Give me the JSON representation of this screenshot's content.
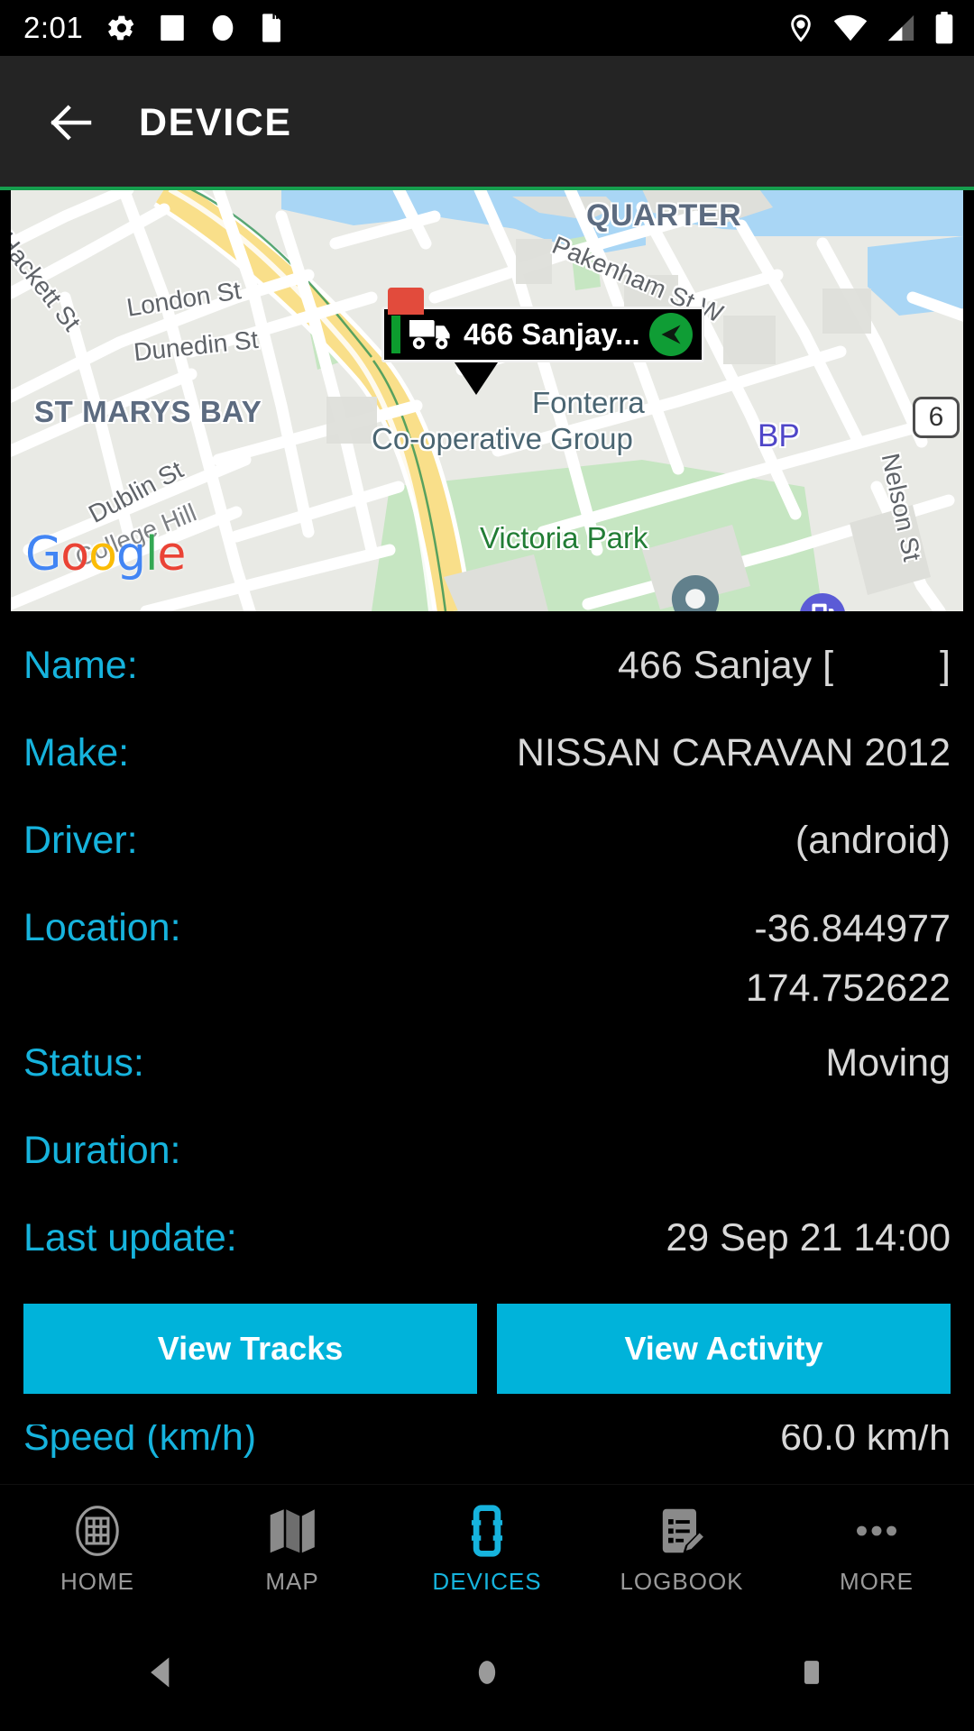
{
  "status_bar": {
    "clock": "2:01",
    "left_icons": [
      "gear-icon",
      "square-icon",
      "circle-icon",
      "sdcard-icon"
    ],
    "right_icons": [
      "location-icon",
      "wifi-icon",
      "cellular-signal-icon",
      "battery-icon"
    ]
  },
  "app_bar": {
    "back_icon": "arrow-back-icon",
    "title": "DEVICE"
  },
  "map": {
    "provider_logo": "Google",
    "marker": {
      "label": "466 Sanjay...",
      "vehicle_icon": "truck-icon",
      "heading_icon": "compass-arrow-icon"
    },
    "street_labels": [
      "Hackett St",
      "London St",
      "Dunedin St",
      "Dublin St",
      "College Hill",
      "Pakenham St W",
      "Nelson St"
    ],
    "area_labels": [
      "ST MARYS BAY",
      "QUARTER"
    ],
    "poi_labels": [
      "Fonterra",
      "Co-operative Group",
      "BP"
    ],
    "park_label": "Victoria Park",
    "highway_shield": "6"
  },
  "details": [
    {
      "label": "Name:",
      "value": "466 Sanjay [",
      "value2": "]",
      "type": "bracketed"
    },
    {
      "label": "Make:",
      "value": "NISSAN CARAVAN 2012"
    },
    {
      "label": "Driver:",
      "value": "(android)"
    },
    {
      "label": "Location:",
      "value": "-36.844977",
      "value2": "174.752622",
      "type": "two-line"
    },
    {
      "label": "Status:",
      "value": "Moving"
    },
    {
      "label": "Duration:",
      "value": ""
    },
    {
      "label": "Last update:",
      "value": "29 Sep 21 14:00"
    }
  ],
  "actions": {
    "view_tracks": "View Tracks",
    "view_activity": "View Activity"
  },
  "clipped_row": {
    "label": "Speed (km/h)",
    "value": "60.0 km/h"
  },
  "bottom_nav": {
    "items": [
      {
        "label": "HOME",
        "icon": "home-grid-icon",
        "active": false
      },
      {
        "label": "MAP",
        "icon": "map-icon",
        "active": false
      },
      {
        "label": "DEVICES",
        "icon": "device-icon",
        "active": true
      },
      {
        "label": "LOGBOOK",
        "icon": "logbook-icon",
        "active": false
      },
      {
        "label": "MORE",
        "icon": "more-dots-icon",
        "active": false
      }
    ]
  },
  "system_nav": {
    "back": "back-triangle-icon",
    "home": "home-circle-icon",
    "recents": "recents-square-icon"
  },
  "colors": {
    "accent": "#16b3dd",
    "button": "#00b3da",
    "appbar": "#242424",
    "background": "#000000",
    "map_divider_green": "#169e4e"
  }
}
